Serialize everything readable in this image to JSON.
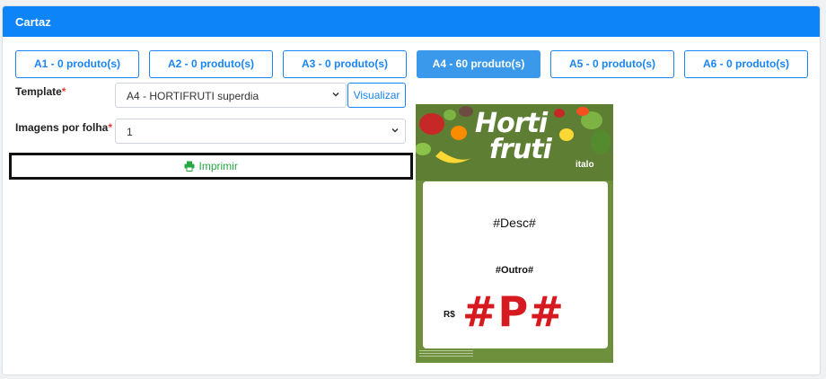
{
  "header": {
    "title": "Cartaz"
  },
  "tabs": [
    {
      "label": "A1 - 0 produto(s)",
      "active": false
    },
    {
      "label": "A2 - 0 produto(s)",
      "active": false
    },
    {
      "label": "A3 - 0 produto(s)",
      "active": false
    },
    {
      "label": "A4 - 60 produto(s)",
      "active": true
    },
    {
      "label": "A5 - 0 produto(s)",
      "active": false
    },
    {
      "label": "A6 - 0 produto(s)",
      "active": false
    }
  ],
  "form": {
    "template_label": "Template",
    "template_value": "A4 - HORTIFRUTI superdia",
    "visualizar_label": "Visualizar",
    "imagens_label": "Imagens por folha",
    "imagens_value": "1",
    "required_mark": "*",
    "print_label": "Imprimir"
  },
  "preview": {
    "brand_line1": "Horti",
    "brand_line2": "fruti",
    "logo": "italo",
    "desc": "#Desc#",
    "outro": "#Outro#",
    "currency": "R$",
    "price": "#P#"
  },
  "colors": {
    "primary": "#0d84f8",
    "success": "#28a745",
    "required": "#e53935",
    "price": "#d71920"
  },
  "icons": {
    "print": "printer-icon",
    "dropdown": "chevron-down-icon"
  }
}
